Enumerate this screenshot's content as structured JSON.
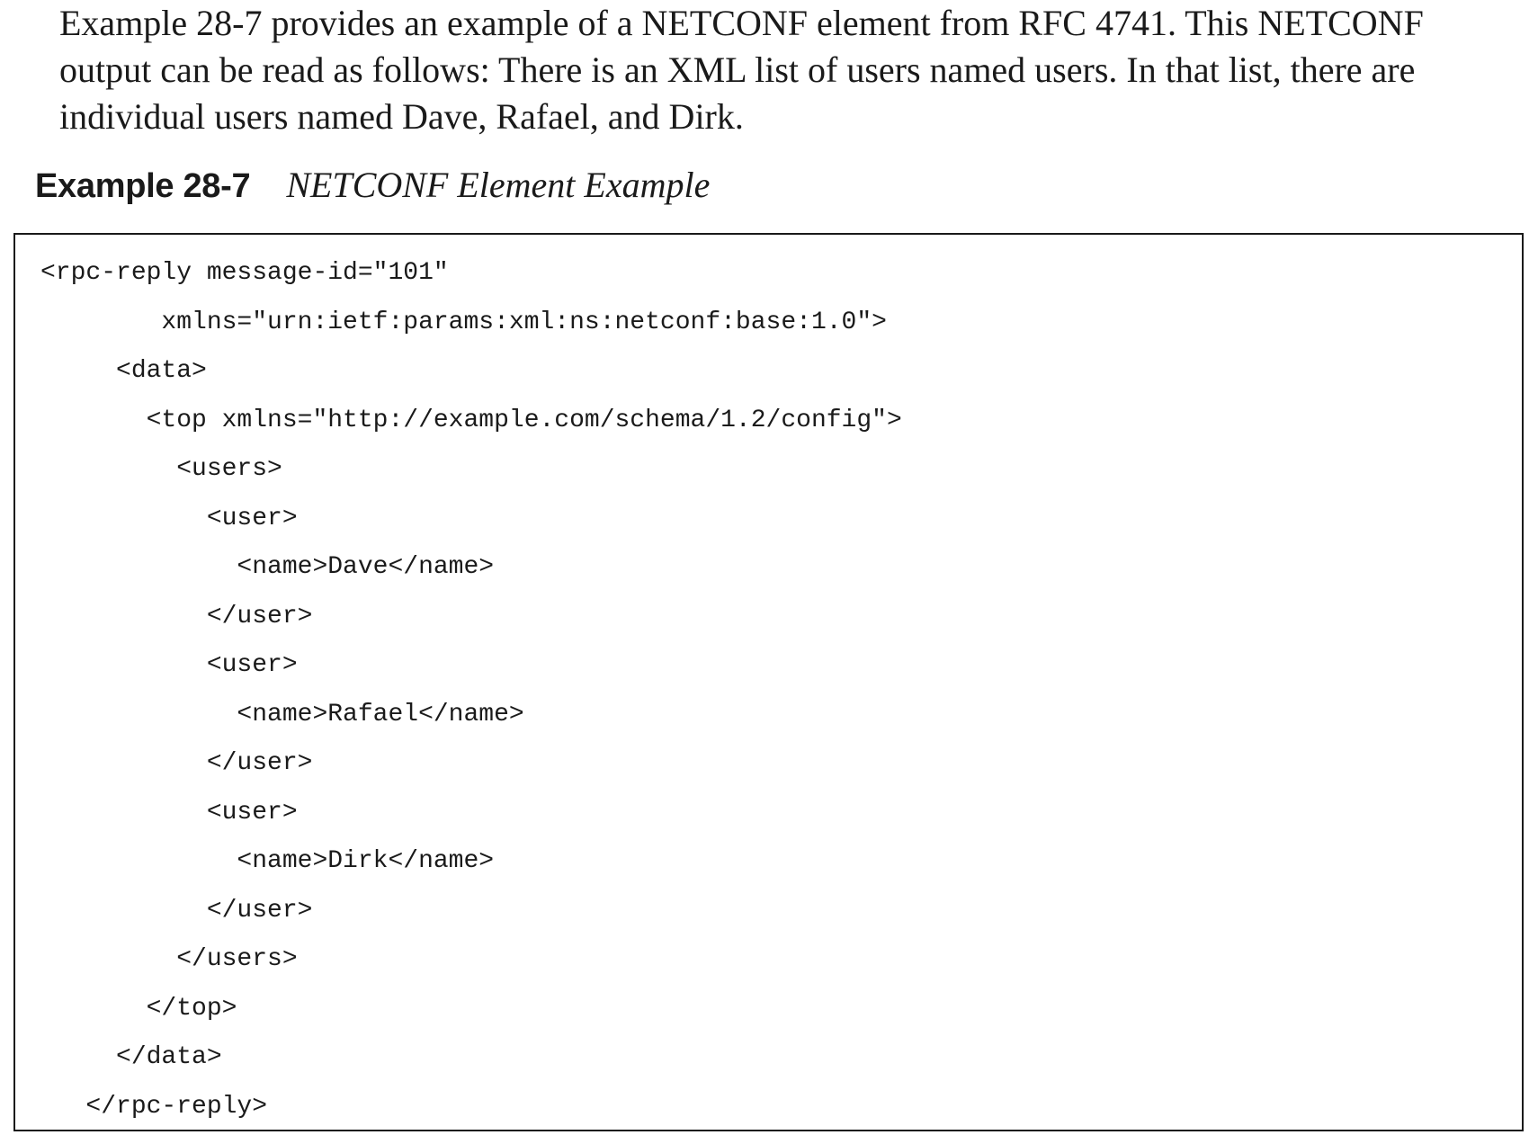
{
  "paragraph": {
    "lines": [
      "Example 28-7 provides an example of a NETCONF element from RFC 4741. This NETCONF",
      "output can be read as follows: There is an XML list of users named users. In that list, there are",
      "individual users named Dave, Rafael, and Dirk."
    ]
  },
  "caption": {
    "label": "Example 28-7",
    "title": "NETCONF Element Example"
  },
  "code": {
    "lines": [
      "<rpc-reply message-id=\"101\"",
      "        xmlns=\"urn:ietf:params:xml:ns:netconf:base:1.0\">",
      "     <data>",
      "       <top xmlns=\"http://example.com/schema/1.2/config\">",
      "         <users>",
      "           <user>",
      "             <name>Dave</name>",
      "           </user>",
      "           <user>",
      "             <name>Rafael</name>",
      "           </user>",
      "           <user>",
      "             <name>Dirk</name>",
      "           </user>",
      "         </users>",
      "       </top>",
      "     </data>",
      "   </rpc-reply>"
    ]
  }
}
